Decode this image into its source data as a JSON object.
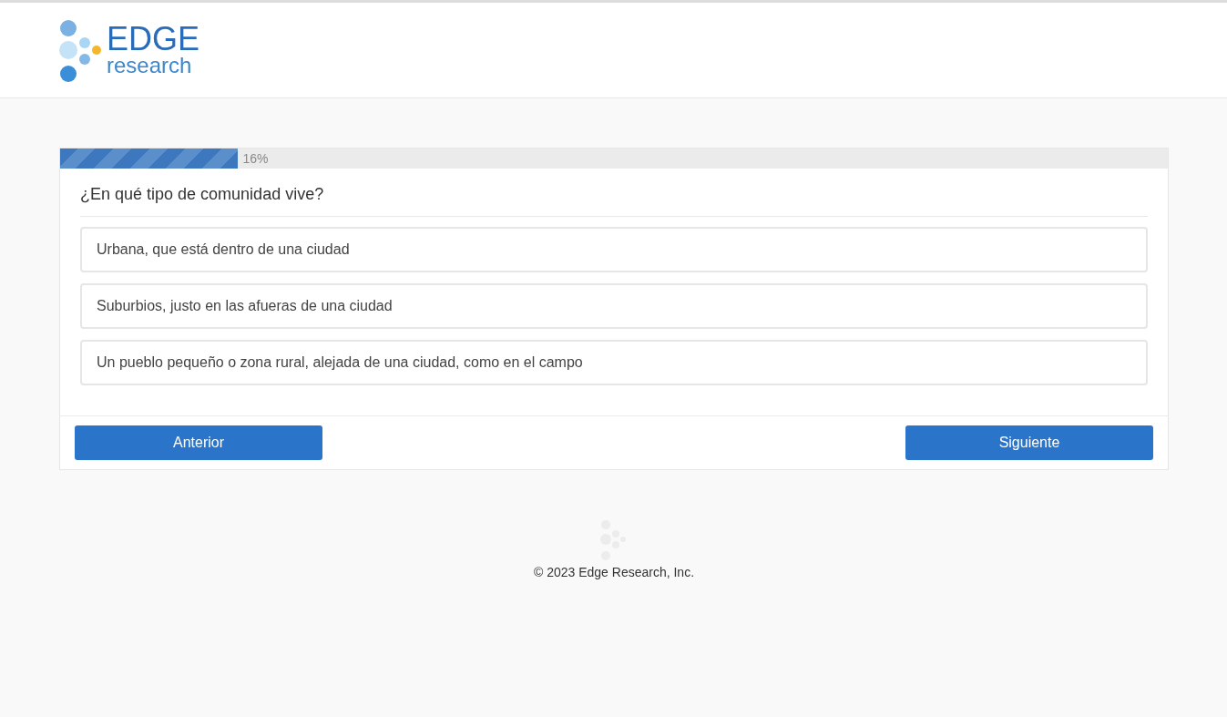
{
  "logo": {
    "name": "EDGE",
    "subtitle": "research"
  },
  "progress": {
    "level": 0.16,
    "reading": "16%"
  },
  "question": "¿En qué tipo de comunidad vive?",
  "options": [
    {
      "label": "Urbana, que está dentro de una ciudad"
    },
    {
      "label": "Suburbios, justo en las afueras de una ciudad"
    },
    {
      "label": "Un pueblo pequeño o zona rural, alejada de una ciudad, como en el campo"
    }
  ],
  "buttons": {
    "back": "Anterior",
    "next": "Siguiente"
  },
  "footer": "© 2023 Edge Research, Inc."
}
